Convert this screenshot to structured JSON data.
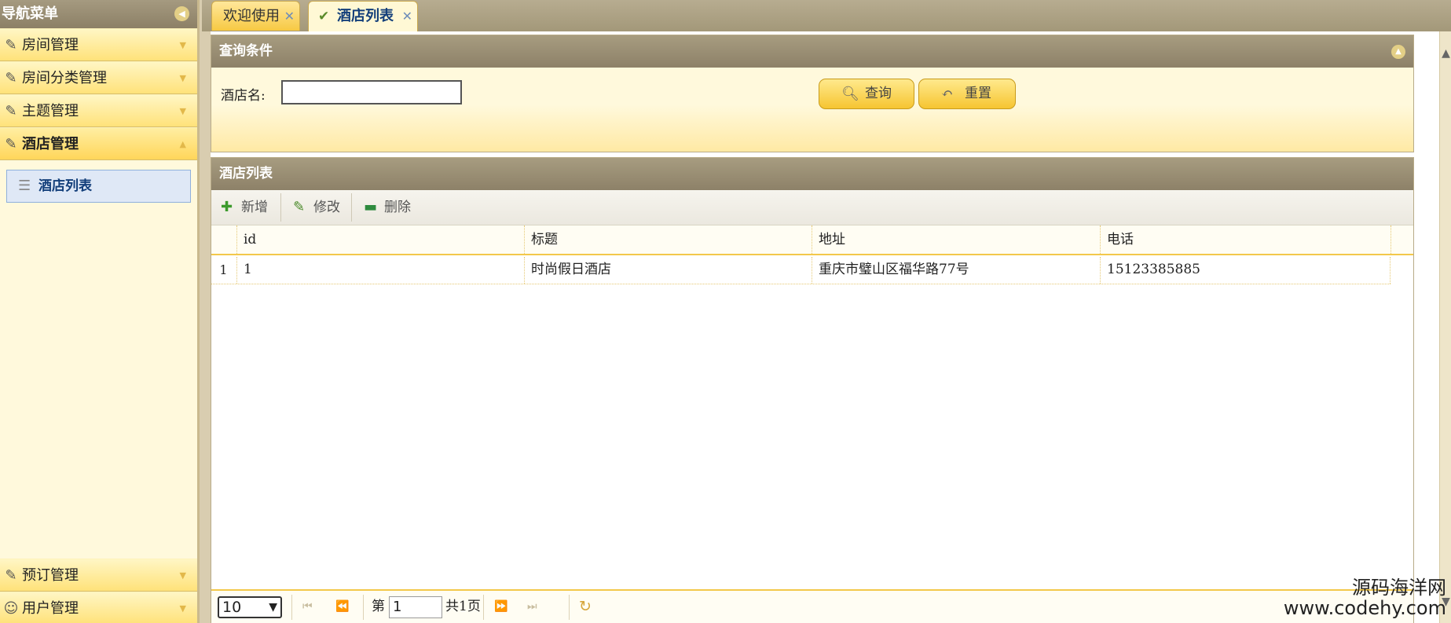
{
  "sidebar": {
    "title": "导航菜单",
    "collapse_icon": "collapse-left-icon",
    "groups": [
      {
        "label": "房间管理",
        "icon": "tool-icon",
        "expanded": false
      },
      {
        "label": "房间分类管理",
        "icon": "tool-icon",
        "expanded": false
      },
      {
        "label": "主题管理",
        "icon": "tool-icon",
        "expanded": false
      },
      {
        "label": "酒店管理",
        "icon": "tool-icon",
        "expanded": true
      },
      {
        "label": "预订管理",
        "icon": "tool-icon",
        "expanded": false
      },
      {
        "label": "用户管理",
        "icon": "users-icon",
        "expanded": false
      }
    ],
    "hotel_children": [
      {
        "label": "酒店列表",
        "icon": "database-icon"
      }
    ]
  },
  "tabs": [
    {
      "label": "欢迎使用",
      "active": false
    },
    {
      "label": "酒店列表",
      "active": true,
      "icon": "check-icon"
    }
  ],
  "query": {
    "title": "查询条件",
    "hotel_name_label": "酒店名:",
    "hotel_name_value": "",
    "search_label": "查询",
    "reset_label": "重置"
  },
  "list": {
    "title": "酒店列表",
    "toolbar": {
      "add": "新增",
      "edit": "修改",
      "delete": "删除"
    },
    "columns": [
      "id",
      "标题",
      "地址",
      "电话"
    ],
    "rows": [
      {
        "rownum": "1",
        "cells": [
          "1",
          "时尚假日酒店",
          "重庆市璧山区福华路77号",
          "15123385885"
        ]
      }
    ]
  },
  "pager": {
    "page_size": "10",
    "page_prefix": "第",
    "current_page": "1",
    "total": "共1页"
  },
  "watermark": {
    "cn": "源码海洋网",
    "url": "www.codehy.com"
  },
  "colors": {
    "accent_yellow": "#ffd65a",
    "header_brown": "#8d8168",
    "selected_blue": "#dfe8f6",
    "text_blue": "#123e7a"
  }
}
